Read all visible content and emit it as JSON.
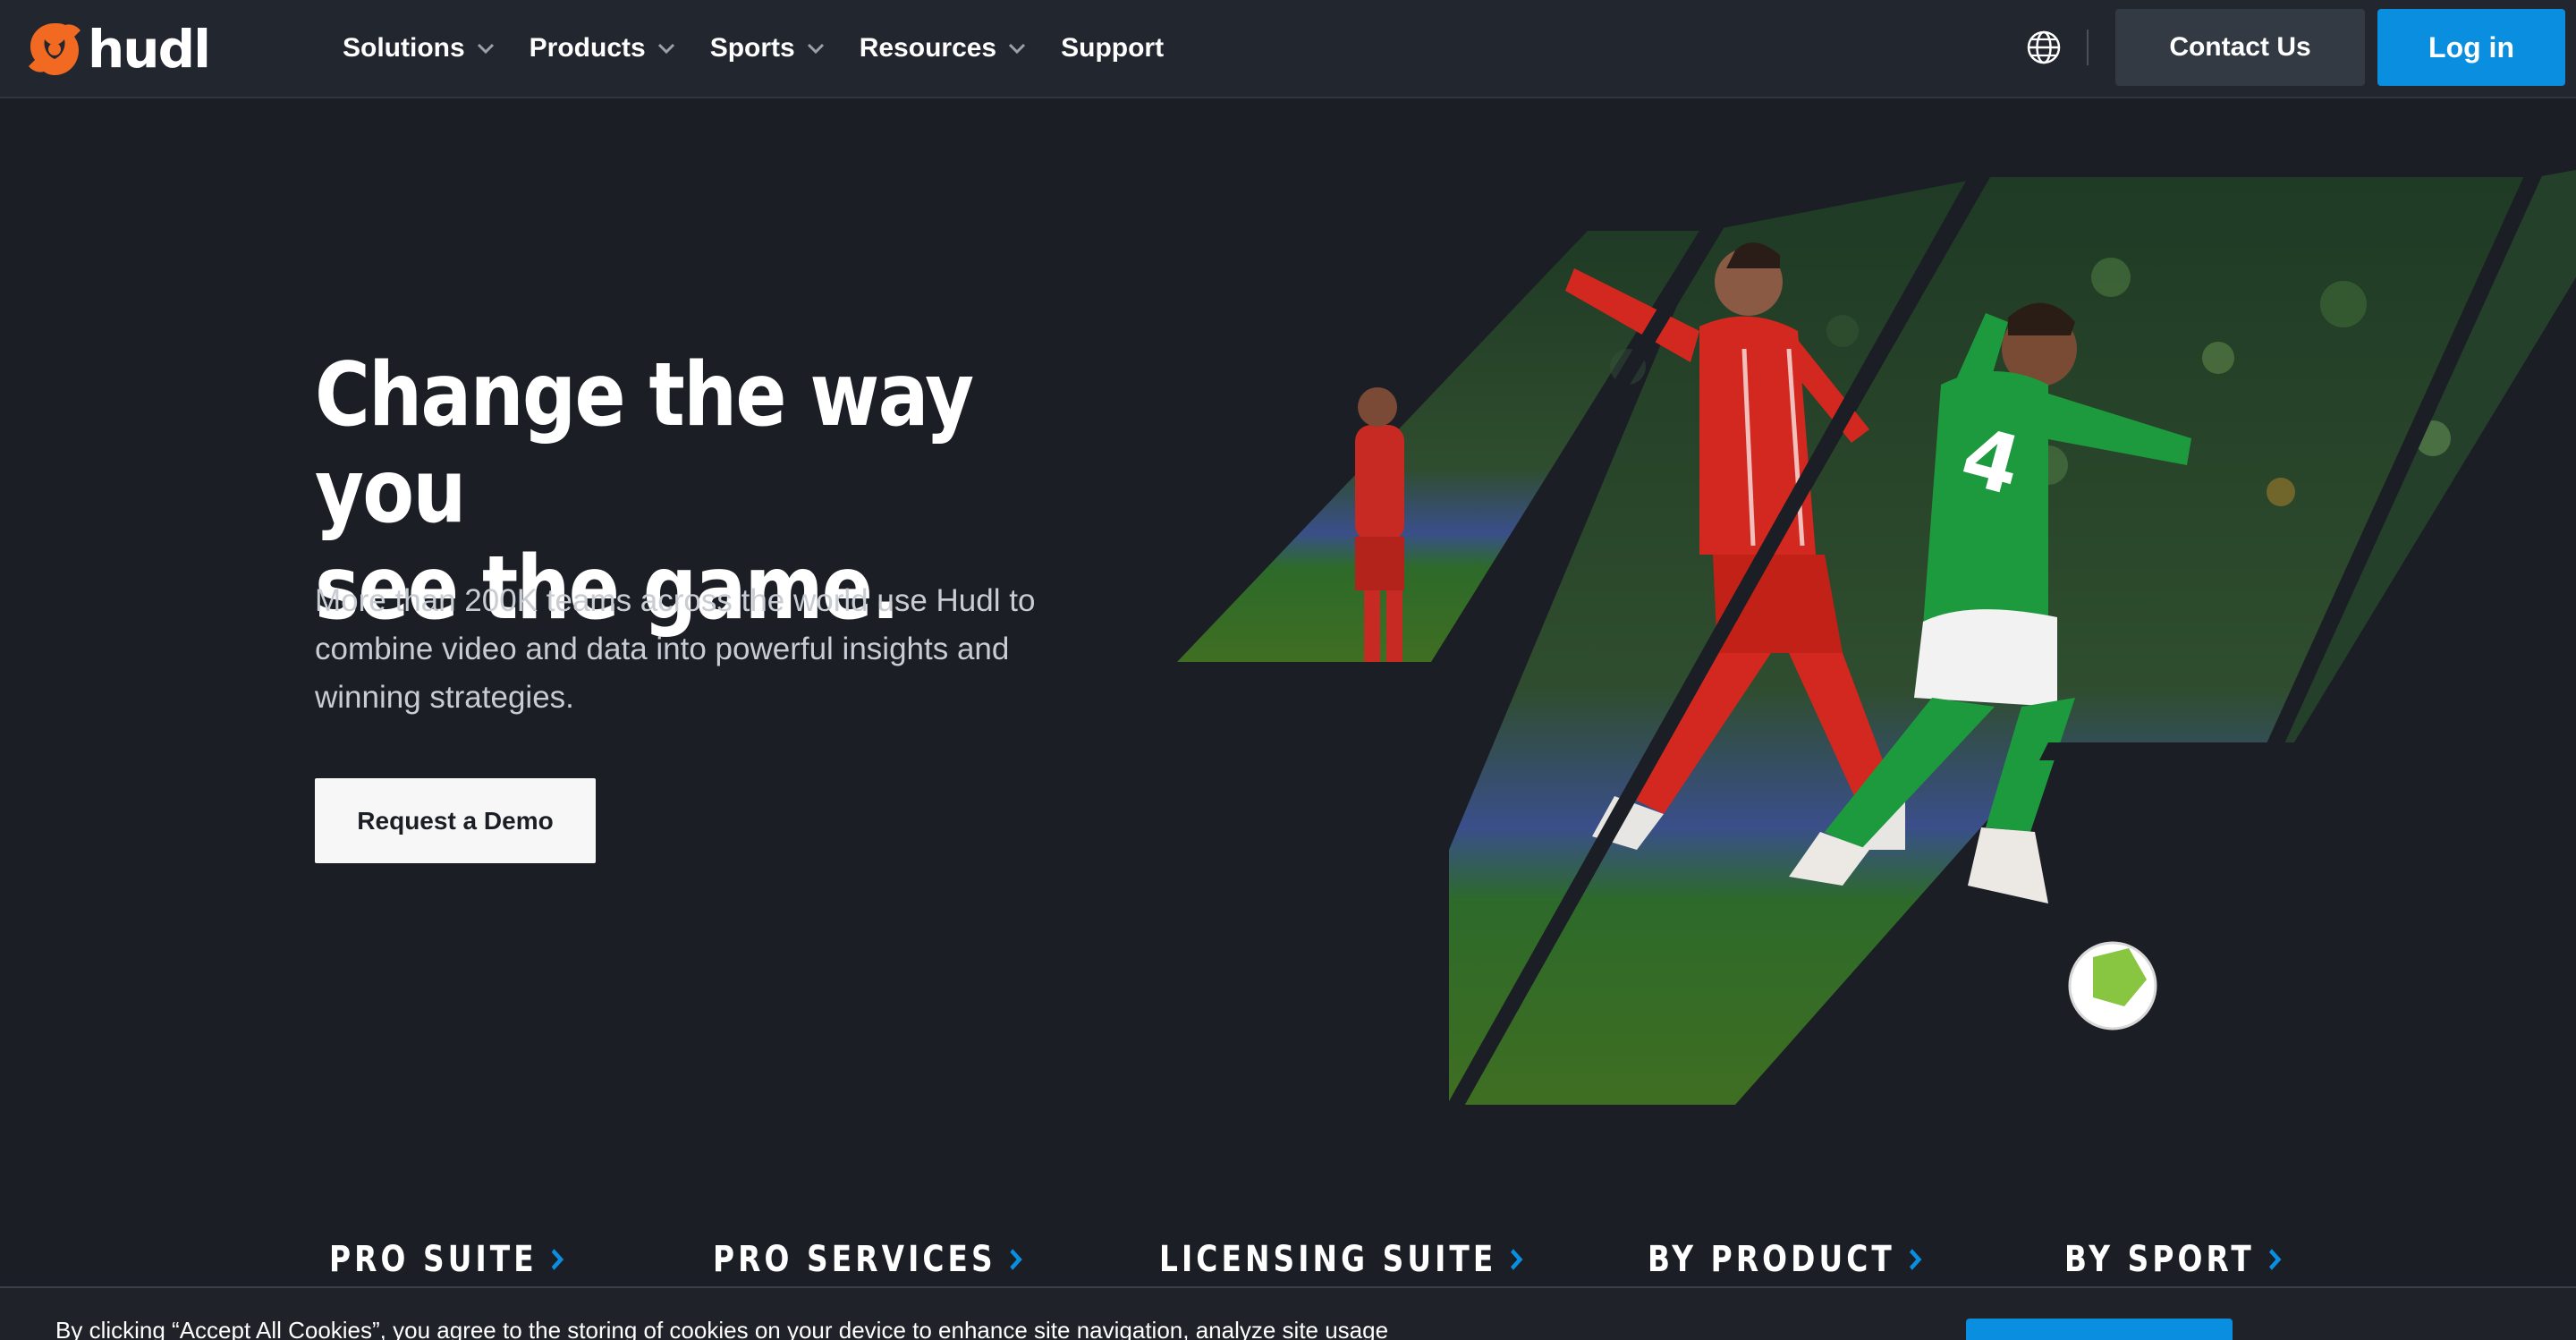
{
  "brand": {
    "name": "hudl",
    "accent": "#f26a21"
  },
  "nav": {
    "items": [
      {
        "label": "Solutions",
        "has_dropdown": true
      },
      {
        "label": "Products",
        "has_dropdown": true
      },
      {
        "label": "Sports",
        "has_dropdown": true
      },
      {
        "label": "Resources",
        "has_dropdown": true
      },
      {
        "label": "Support",
        "has_dropdown": false
      }
    ],
    "globe_icon": "globe-icon",
    "contact_label": "Contact Us",
    "login_label": "Log in",
    "login_color": "#0a8fe0"
  },
  "hero": {
    "title_line1": "Change the way you",
    "title_line2": "see the game.",
    "subtitle": "More than 200K teams across the world use Hudl to combine video and data into powerful insights and winning strategies.",
    "cta_label": "Request a Demo"
  },
  "categories": [
    {
      "label": "PRO SUITE"
    },
    {
      "label": "PRO SERVICES"
    },
    {
      "label": "LICENSING SUITE"
    },
    {
      "label": "BY PRODUCT"
    },
    {
      "label": "BY SPORT"
    }
  ],
  "cookie": {
    "text": "By clicking “Accept All Cookies”, you agree to the storing of cookies on your device to enhance site navigation, analyze site usage"
  }
}
